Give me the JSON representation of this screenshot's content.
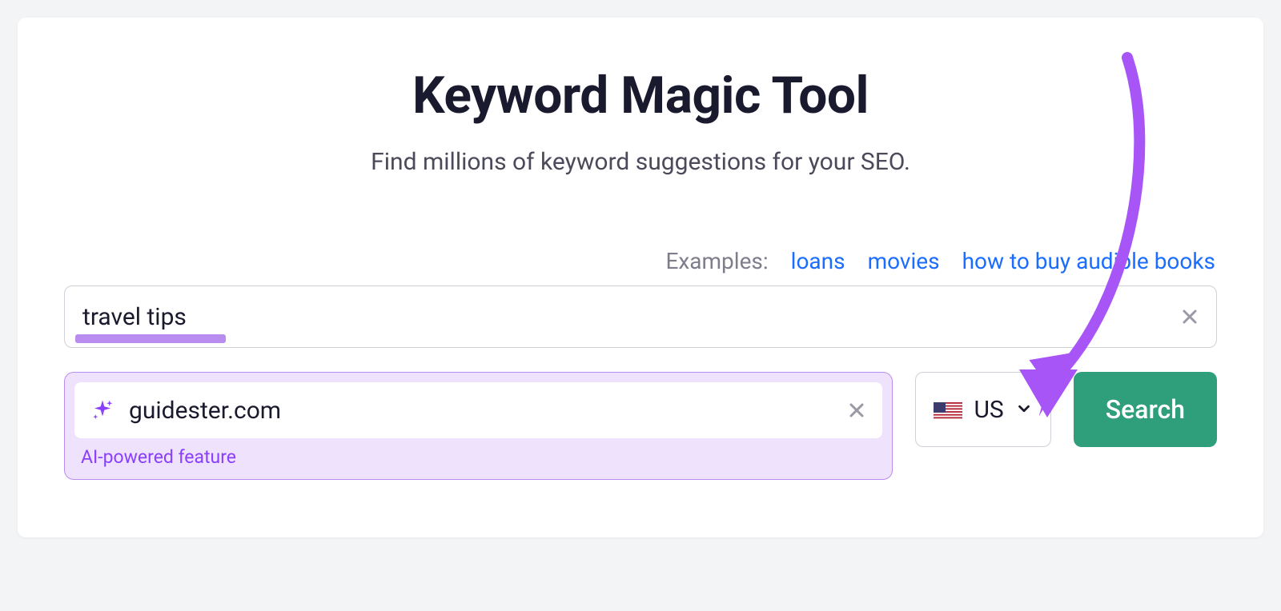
{
  "header": {
    "title": "Keyword Magic Tool",
    "subtitle": "Find millions of keyword suggestions for your SEO."
  },
  "examples": {
    "label": "Examples:",
    "links": [
      "loans",
      "movies",
      "how to buy audible books"
    ]
  },
  "keyword_input": {
    "value": "travel tips"
  },
  "domain_input": {
    "value": "guidester.com",
    "caption": "AI-powered feature"
  },
  "country_select": {
    "code": "US"
  },
  "search_button": {
    "label": "Search"
  },
  "annotation": {
    "arrow_color": "#a855f7"
  }
}
